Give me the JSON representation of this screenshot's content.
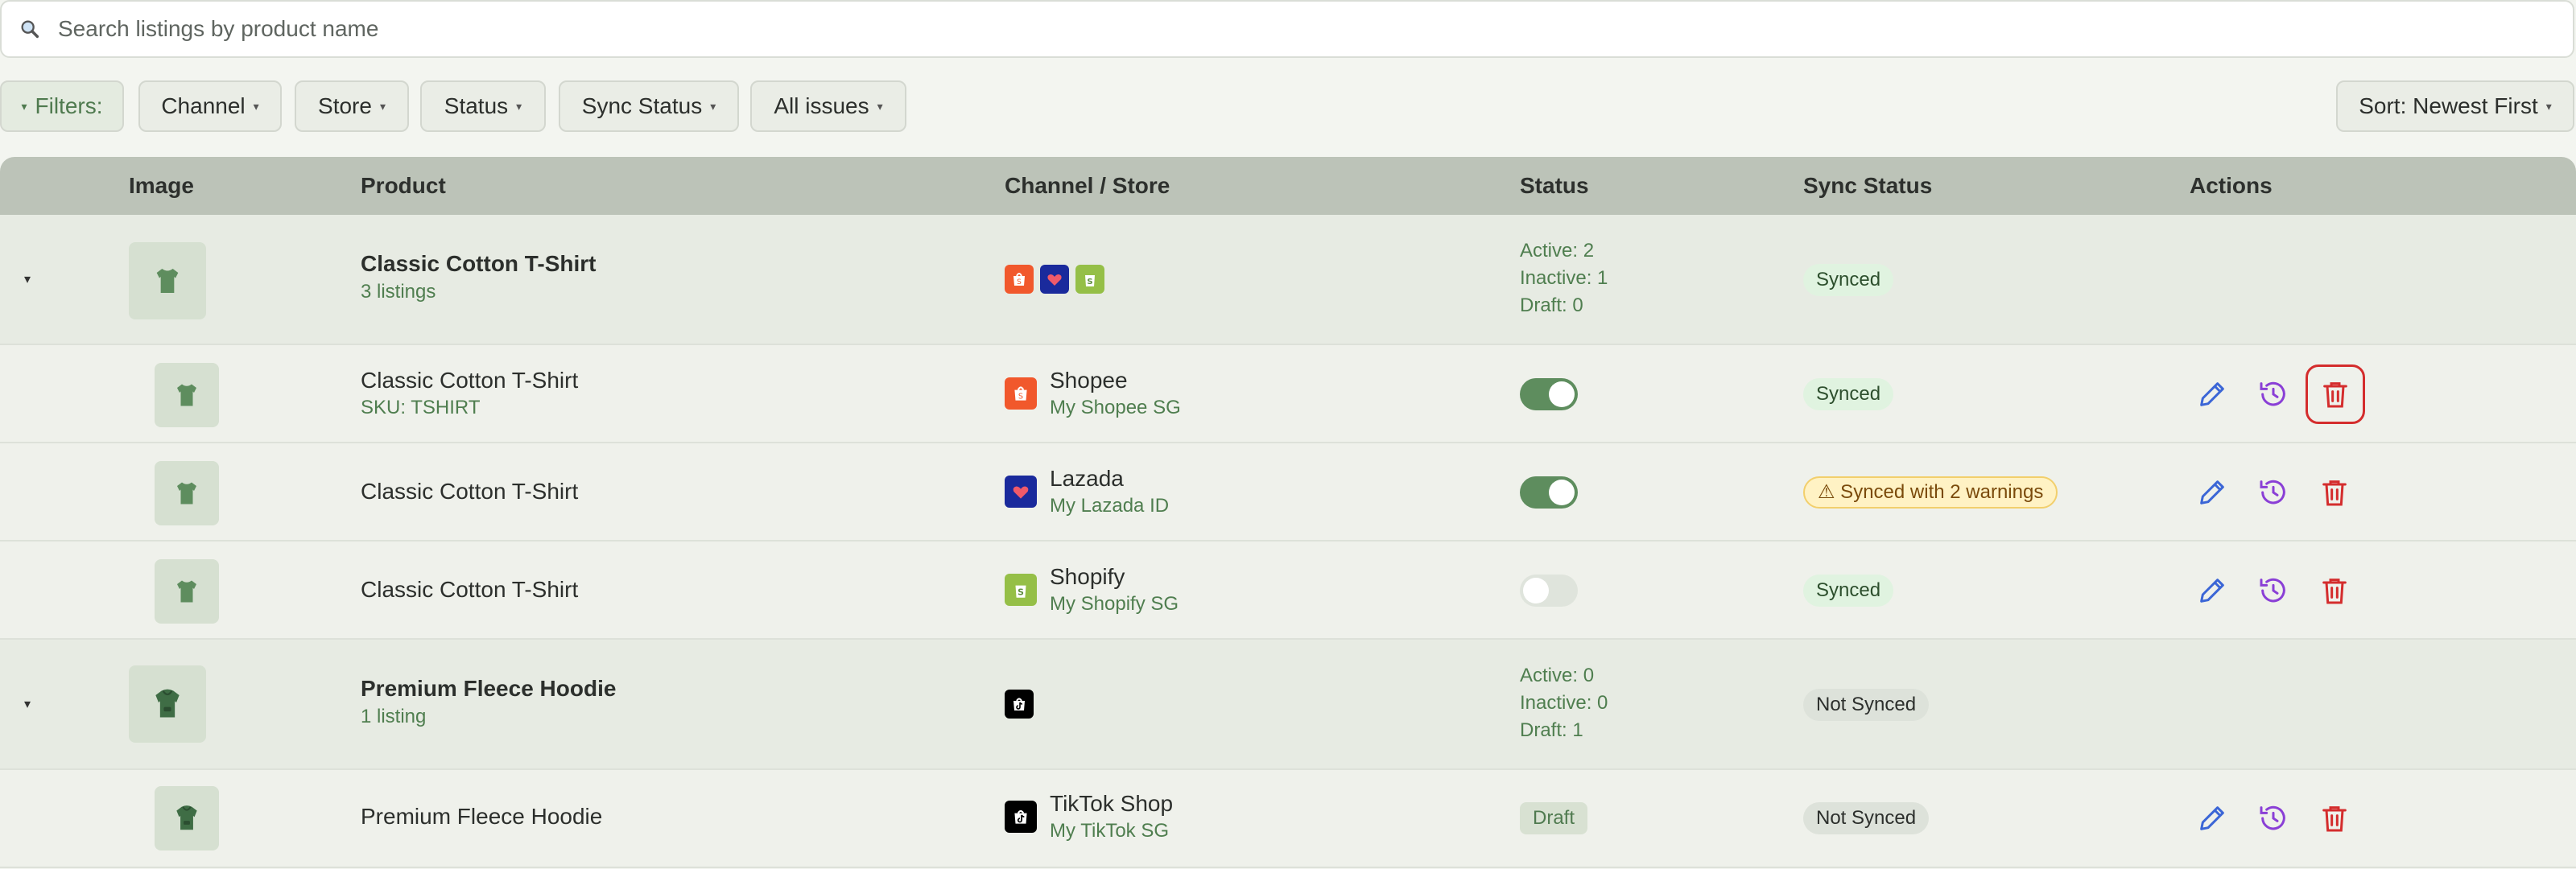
{
  "search": {
    "placeholder": "Search listings by product name",
    "value": ""
  },
  "filters": {
    "toggle_label": "Filters:",
    "chips": [
      "Channel",
      "Store",
      "Status",
      "Sync Status",
      "All issues"
    ],
    "sort_label": "Sort: Newest First"
  },
  "table": {
    "headers": {
      "image": "Image",
      "product": "Product",
      "channel_store": "Channel / Store",
      "status": "Status",
      "sync_status": "Sync Status",
      "actions": "Actions"
    },
    "groups": [
      {
        "name": "Classic Cotton T-Shirt",
        "listing_count": "3 listings",
        "channels": [
          "shopee-icon",
          "lazada-icon",
          "shopify-icon"
        ],
        "status_counts": [
          "Active: 2",
          "Inactive: 1",
          "Draft: 0"
        ],
        "sync_status": "Synced",
        "listings": [
          {
            "name": "Classic Cotton T-Shirt",
            "sku": "SKU: TSHIRT",
            "channel": "Shopee",
            "store": "My Shopee SG",
            "active": true,
            "sync_status": "Synced"
          },
          {
            "name": "Classic Cotton T-Shirt",
            "sku": "",
            "channel": "Lazada",
            "store": "My Lazada ID",
            "active": true,
            "sync_status": "⚠ Synced with 2 warnings"
          },
          {
            "name": "Classic Cotton T-Shirt",
            "sku": "",
            "channel": "Shopify",
            "store": "My Shopify SG",
            "active": false,
            "sync_status": "Synced"
          }
        ]
      },
      {
        "name": "Premium Fleece Hoodie",
        "listing_count": "1 listing",
        "channels": [
          "tiktok-shop-icon"
        ],
        "status_counts": [
          "Active: 0",
          "Inactive: 0",
          "Draft: 1"
        ],
        "sync_status": "Not Synced",
        "listings": [
          {
            "name": "Premium Fleece Hoodie",
            "sku": "",
            "channel": "TikTok Shop",
            "store": "My TikTok SG",
            "status_badge": "Draft",
            "sync_status": "Not Synced"
          }
        ]
      }
    ]
  },
  "colors": {
    "accent_green": "#5e8d5e",
    "edit_blue": "#3b66d6",
    "history_purple": "#8a3fd6",
    "delete_red": "#d42d2d",
    "shopee": "#f1582c",
    "lazada": "#1a2a9c",
    "shopify": "#95bf47"
  }
}
